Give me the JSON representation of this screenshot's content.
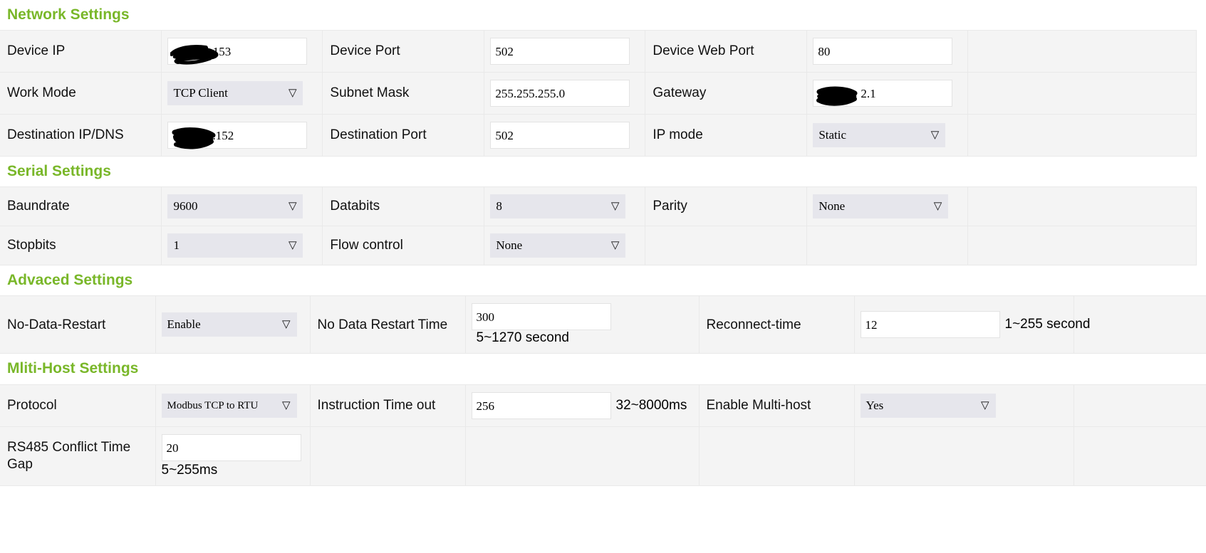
{
  "sections": [
    {
      "title": "Network Settings",
      "rows": [
        {
          "cells": [
            {
              "label": "Device IP",
              "type": "text-redacted",
              "value": ".153"
            },
            {
              "label": "Device Port",
              "type": "text",
              "value": "502"
            },
            {
              "label": "Device Web Port",
              "type": "text",
              "value": "80"
            }
          ]
        },
        {
          "cells": [
            {
              "label": "Work Mode",
              "type": "select",
              "value": "TCP Client"
            },
            {
              "label": "Subnet Mask",
              "type": "text",
              "value": "255.255.255.0"
            },
            {
              "label": "Gateway",
              "type": "text-redacted",
              "value": "2.1"
            }
          ]
        },
        {
          "cells": [
            {
              "label": "Destination IP/DNS",
              "type": "text-redacted",
              "value": ".152"
            },
            {
              "label": "Destination Port",
              "type": "text",
              "value": "502"
            },
            {
              "label": "IP mode",
              "type": "select",
              "value": "Static"
            }
          ]
        }
      ]
    },
    {
      "title": "Serial Settings",
      "rows": [
        {
          "cells": [
            {
              "label": "Baundrate",
              "type": "select",
              "value": "9600"
            },
            {
              "label": "Databits",
              "type": "select",
              "value": "8"
            },
            {
              "label": "Parity",
              "type": "select",
              "value": "None"
            }
          ]
        },
        {
          "cells": [
            {
              "label": "Stopbits",
              "type": "select",
              "value": "1"
            },
            {
              "label": "Flow control",
              "type": "select",
              "value": "None"
            },
            {
              "label": "",
              "type": "empty",
              "value": ""
            }
          ]
        }
      ]
    },
    {
      "title": "Advaced Settings",
      "rows": [
        {
          "cells": [
            {
              "label": "No-Data-Restart",
              "type": "select",
              "value": "Enable"
            },
            {
              "label": "No Data Restart Time",
              "type": "text",
              "value": "300",
              "hint": "5~1270 second"
            },
            {
              "label": "Reconnect-time",
              "type": "text",
              "value": "12",
              "hint": "1~255 second"
            }
          ]
        }
      ]
    },
    {
      "title": "Mliti-Host Settings",
      "rows": [
        {
          "cells": [
            {
              "label": "Protocol",
              "type": "select",
              "value": "Modbus TCP to RTU"
            },
            {
              "label": "Instruction Time out",
              "type": "text",
              "value": "256",
              "hint": "32~8000ms"
            },
            {
              "label": "Enable Multi-host",
              "type": "select",
              "value": "Yes"
            }
          ]
        },
        {
          "cells": [
            {
              "label": "RS485 Conflict Time Gap",
              "type": "text-below",
              "value": "20",
              "hint": "5~255ms"
            },
            {
              "label": "",
              "type": "empty",
              "value": ""
            },
            {
              "label": "",
              "type": "empty",
              "value": ""
            }
          ]
        }
      ]
    }
  ],
  "icons": {
    "chevron": "⌄"
  },
  "colors": {
    "heading_green": "#79b729",
    "row_bg": "#f4f4f4",
    "select_bg": "#e6e6ec",
    "input_bg": "#ffffff",
    "border": "#e9e9e9"
  }
}
